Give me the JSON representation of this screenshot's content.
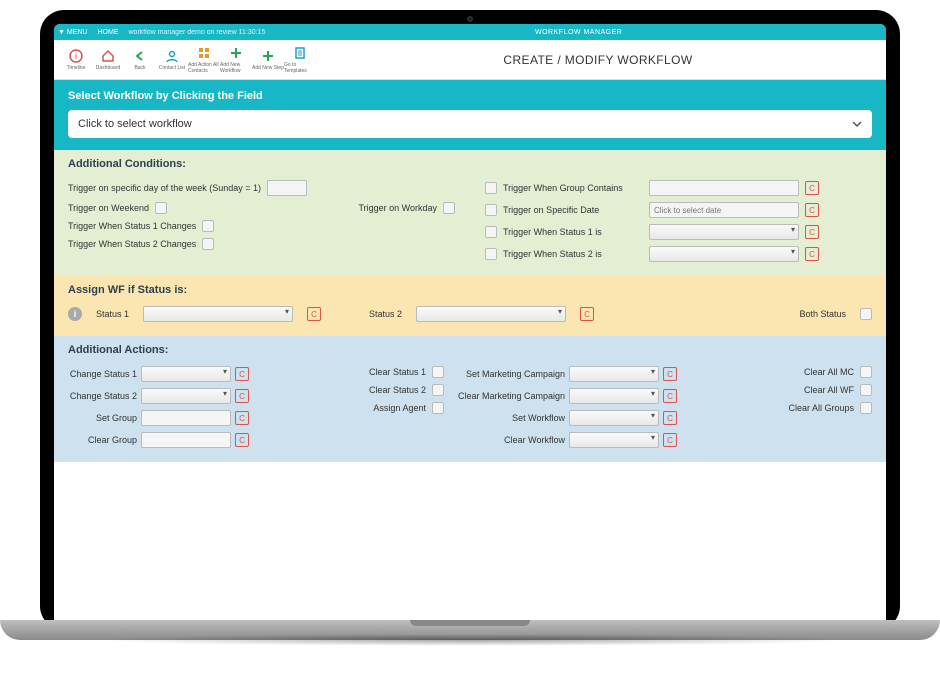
{
  "topbar": {
    "menu": "MENU",
    "home": "HOME",
    "status": "workflow manager demo on review 11:30:15",
    "title": "WORKFLOW MANAGER"
  },
  "tools": [
    {
      "label": "Timeline",
      "icon": "info",
      "color": "#d9534f"
    },
    {
      "label": "Dashboard",
      "icon": "home",
      "color": "#d9534f"
    },
    {
      "label": "Back",
      "icon": "back",
      "color": "#2aa54a"
    },
    {
      "label": "Contact List",
      "icon": "user",
      "color": "#1aa2c9"
    },
    {
      "label": "Add Action All Contacts",
      "icon": "grid",
      "color": "#e69a1f"
    },
    {
      "label": "Add New Workflow",
      "icon": "plus",
      "color": "#2aa54a"
    },
    {
      "label": "Add New Step",
      "icon": "plus",
      "color": "#2aa54a"
    },
    {
      "label": "Go to Templates",
      "icon": "doc",
      "color": "#1aa2c9"
    }
  ],
  "toolbar_title": "CREATE / MODIFY WORKFLOW",
  "select_section": {
    "heading": "Select Workflow by Clicking the Field",
    "placeholder": "Click to select workflow"
  },
  "conditions": {
    "heading": "Additional Conditions:",
    "left": [
      {
        "label": "Trigger on specific day of the week (Sunday = 1)",
        "input": "text"
      },
      {
        "label": "Trigger on Weekend",
        "secondary": "Trigger on Workday"
      },
      {
        "label": "Trigger When Status 1 Changes"
      },
      {
        "label": "Trigger When Status 2 Changes"
      }
    ],
    "right": [
      {
        "label": "Trigger When Group Contains",
        "type": "text",
        "clear": true
      },
      {
        "label": "Trigger on Specific Date",
        "type": "text",
        "placeholder": "Click to select date",
        "clear": true
      },
      {
        "label": "Trigger When Status 1 is",
        "type": "select",
        "clear": true
      },
      {
        "label": "Trigger When Status 2 is",
        "type": "select",
        "clear": true
      }
    ]
  },
  "assign": {
    "heading": "Assign WF if Status is:",
    "status1": "Status 1",
    "status2": "Status 2",
    "both": "Both Status"
  },
  "actions": {
    "heading": "Additional Actions:",
    "col1": [
      {
        "label": "Change Status 1",
        "type": "select",
        "clear": true
      },
      {
        "label": "Change Status 2",
        "type": "select",
        "clear": true
      },
      {
        "label": "Set Group",
        "type": "text",
        "clear": true
      },
      {
        "label": "Clear Group",
        "type": "text",
        "clear": true
      }
    ],
    "col2": [
      {
        "label": "Clear Status 1"
      },
      {
        "label": "Clear Status 2"
      },
      {
        "label": "Assign Agent"
      }
    ],
    "col3": [
      {
        "label": "Set Marketing Campaign",
        "type": "select",
        "clear": true
      },
      {
        "label": "Clear Marketing Campaign",
        "type": "select",
        "clear": true
      },
      {
        "label": "Set Workflow",
        "type": "select",
        "clear": true
      },
      {
        "label": "Clear Workflow",
        "type": "select",
        "clear": true
      }
    ],
    "col4": [
      {
        "label": "Clear All MC"
      },
      {
        "label": "Clear All WF"
      },
      {
        "label": "Clear All Groups"
      }
    ]
  },
  "clear_btn": "C"
}
